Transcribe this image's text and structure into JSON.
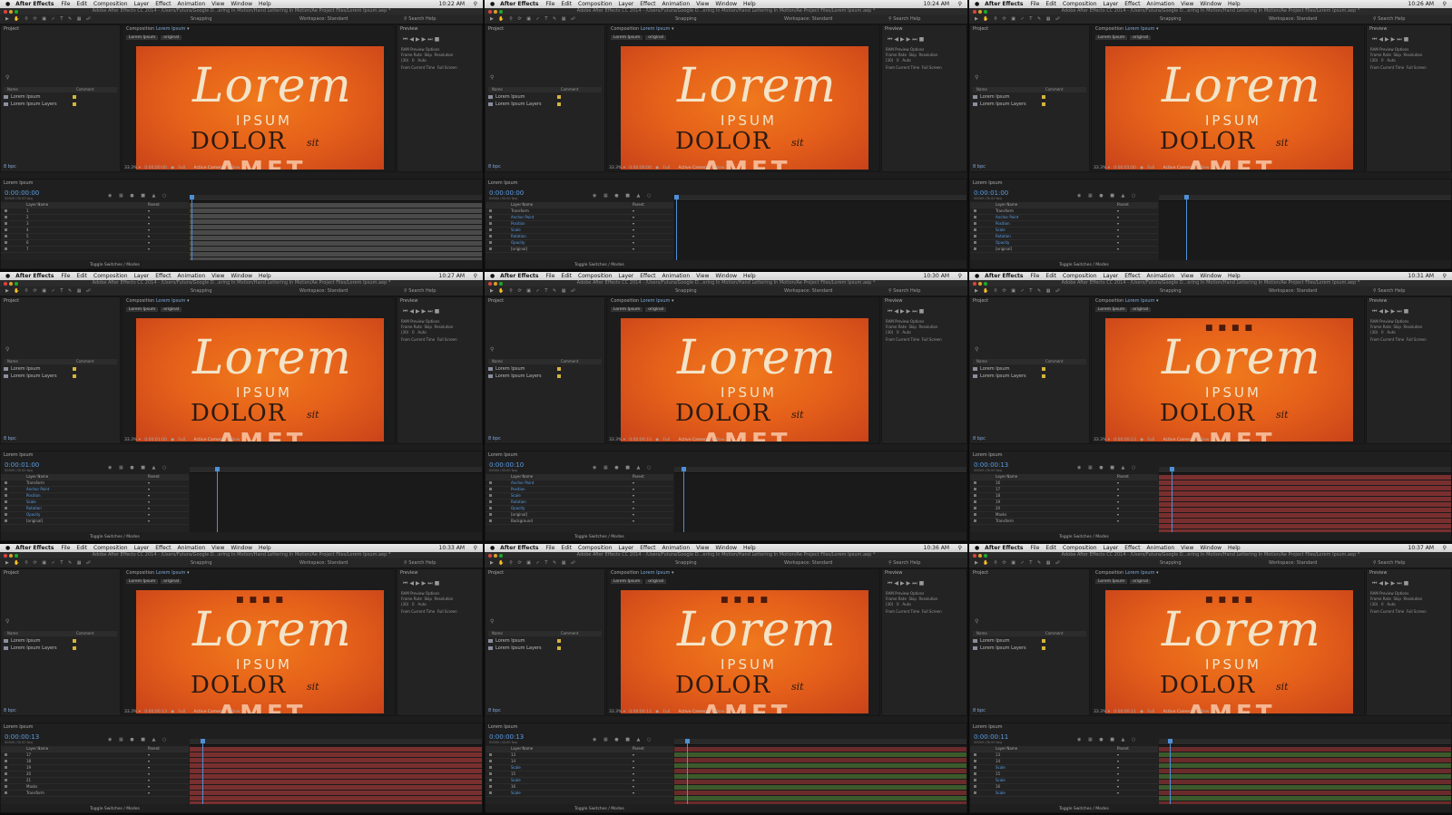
{
  "menubar": {
    "app": "After Effects",
    "items": [
      "File",
      "Edit",
      "Composition",
      "Layer",
      "Effect",
      "Animation",
      "View",
      "Window",
      "Help"
    ]
  },
  "window_title": "Adobe After Effects CC 2014 - /Users/Futura/Google D...ering In Motion/Hand Lettering In Motion/Ae Project Files/Lorem Ipsum.aep *",
  "toolbar": {
    "snapping": "Snapping",
    "workspace_label": "Workspace:",
    "workspace_value": "Standard",
    "search_help": "Search Help"
  },
  "panels": {
    "project": "Project",
    "composition_prefix": "Composition",
    "comp_name": "Lorem Ipsum",
    "preview": "Preview"
  },
  "composition": {
    "sub_tabs": [
      "Lorem Ipsum",
      "original"
    ],
    "zoom": "33.3%",
    "resolution": "Full",
    "camera": "Active Camera",
    "view": "1 View"
  },
  "preview": {
    "options": "RAM Preview Options",
    "frame_rate": "Frame Rate",
    "skip": "Skip",
    "resolution": "Resolution",
    "fps": "(30)",
    "skip_val": "0",
    "res_val": "Auto",
    "from_current": "From Current Time",
    "full_screen": "Full Screen"
  },
  "project": {
    "items": [
      "Lorem Ipsum",
      "Lorem Ipsum Layers"
    ],
    "columns": [
      "Name",
      "Comment"
    ],
    "footer": "8 bpc"
  },
  "artwork": {
    "line1": "Lorem",
    "line2": "IPSUM",
    "line3": "DOLOR",
    "line3_small": "sit",
    "line4": "AMET"
  },
  "timeline": {
    "tab": "Lorem Ipsum",
    "fps": "00000 (30.00 fps)",
    "column_layer": "Layer Name",
    "column_parent": "Parent",
    "footer": "Toggle Switches / Modes"
  },
  "tiles": [
    {
      "clock": "10:22 AM",
      "time": "0:00:00:00",
      "layers": [
        "1",
        "2",
        "3",
        "4",
        "5",
        "6",
        "7"
      ]
    },
    {
      "clock": "10:24 AM",
      "time": "0:00:00:00",
      "layers": [
        "Transform",
        "Anchor Point",
        "Position",
        "Scale",
        "Rotation",
        "Opacity",
        "[original]"
      ]
    },
    {
      "clock": "10:26 AM",
      "time": "0:00:01:00",
      "layers": [
        "Transform",
        "Anchor Point",
        "Position",
        "Scale",
        "Rotation",
        "Opacity",
        "[original]"
      ]
    },
    {
      "clock": "10:27 AM",
      "time": "0:00:01:00",
      "layers": [
        "Transform",
        "Anchor Point",
        "Position",
        "Scale",
        "Rotation",
        "Opacity",
        "[original]"
      ]
    },
    {
      "clock": "10:30 AM",
      "time": "0:00:00:10",
      "layers": [
        "Anchor Point",
        "Position",
        "Scale",
        "Rotation",
        "Opacity",
        "[original]",
        "Background"
      ]
    },
    {
      "clock": "10:31 AM",
      "time": "0:00:00:13",
      "layers": [
        "16",
        "17",
        "18",
        "19",
        "20",
        "Masks",
        "Transform"
      ]
    },
    {
      "clock": "10:33 AM",
      "time": "0:00:00:13",
      "layers": [
        "17",
        "18",
        "19",
        "20",
        "21",
        "Masks",
        "Transform"
      ]
    },
    {
      "clock": "10:36 AM",
      "time": "0:00:00:13",
      "layers": [
        "13",
        "14",
        "Scale",
        "15",
        "Scale",
        "16",
        "Scale"
      ]
    },
    {
      "clock": "10:37 AM",
      "time": "0:00:00:11",
      "layers": [
        "13",
        "14",
        "Scale",
        "15",
        "Scale",
        "16",
        "Scale"
      ]
    }
  ],
  "colors": {
    "accent_blue": "#4f8fd6",
    "canvas_orange": "#e5601a",
    "track_red": "#7a2f2f",
    "label_yellow": "#d4b43b"
  }
}
